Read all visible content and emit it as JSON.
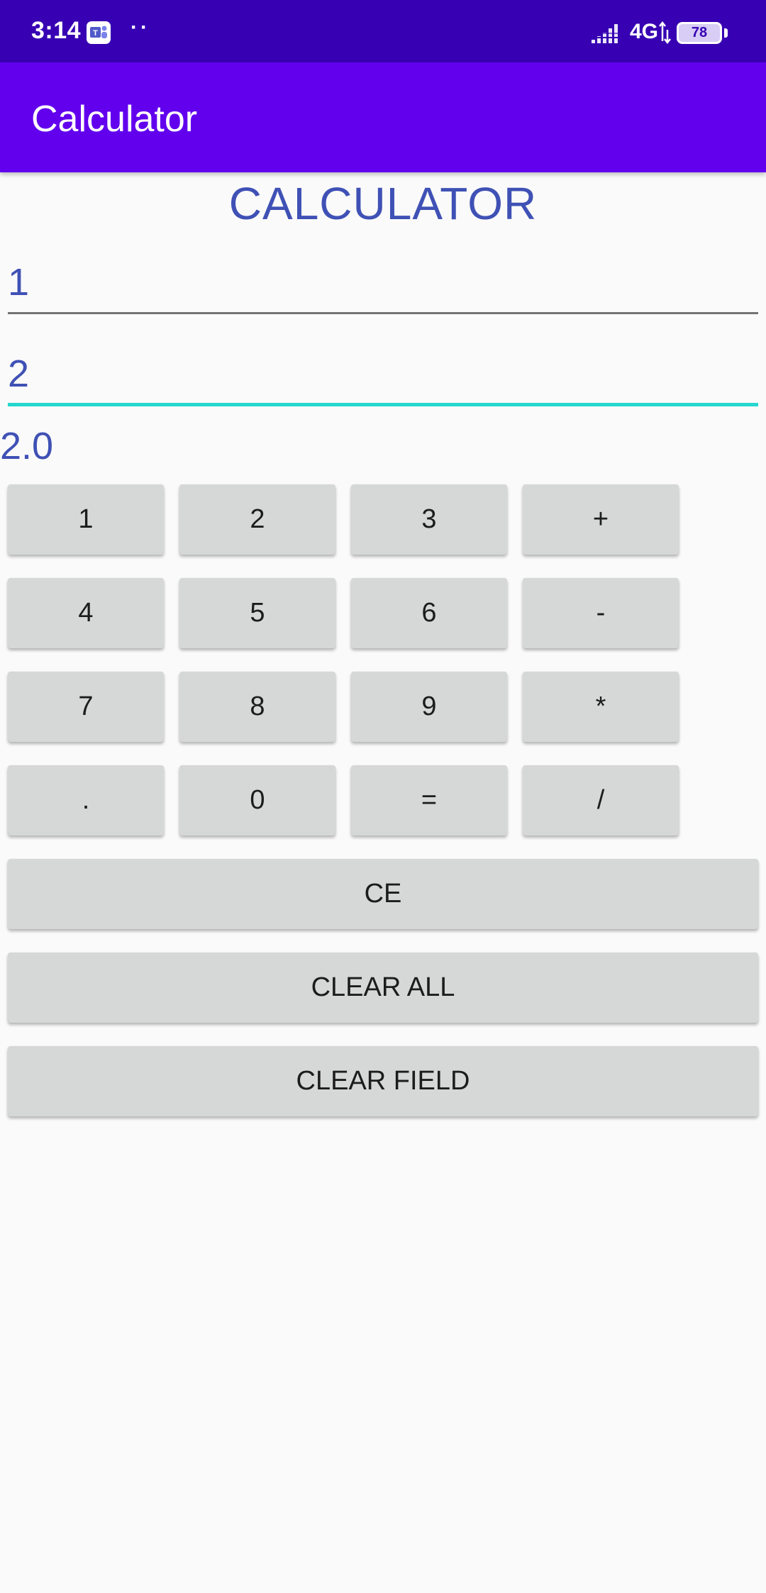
{
  "status_bar": {
    "time": "3:14",
    "dots": "··",
    "network": "4G",
    "battery": "78",
    "battery_level": 0.78,
    "icons": [
      "teams-icon",
      "signal-icon",
      "data-arrows-icon",
      "battery-icon"
    ]
  },
  "app_bar": {
    "title": "Calculator"
  },
  "main": {
    "heading": "CALCULATOR",
    "field_1_value": "1",
    "field_2_value": "2",
    "result": "2.0",
    "keys": [
      "1",
      "2",
      "3",
      "+",
      "4",
      "5",
      "6",
      "-",
      "7",
      "8",
      "9",
      "*",
      ".",
      "0",
      "=",
      "/"
    ],
    "ce_label": "CE",
    "clear_all_label": "CLEAR ALL",
    "clear_field_label": "CLEAR FIELD"
  },
  "colors": {
    "status_bar": "#3700b3",
    "app_bar": "#6200ee",
    "accent_text": "#3f51b5",
    "focused_underline": "#26d7cf",
    "button_bg": "#d6d7d7"
  }
}
